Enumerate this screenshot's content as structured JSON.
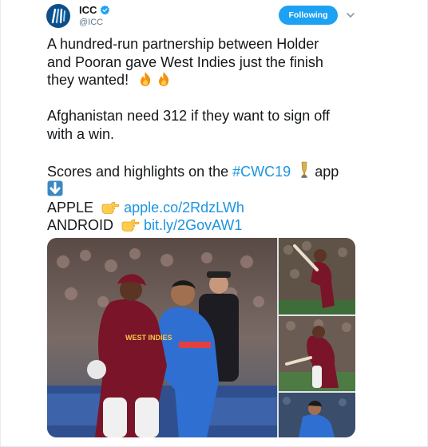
{
  "account": {
    "display_name": "ICC",
    "handle": "@ICC",
    "avatar_icon": "icc-logo-icon",
    "verified_icon": "verified-badge-icon",
    "verified_color": "#1da1f2"
  },
  "follow_button": {
    "label": "Following",
    "color": "#1da1f2"
  },
  "menu_icon": "chevron-down-icon",
  "tweet": {
    "p1": {
      "line1": "A hundred-run partnership between Holder",
      "line2": "and Pooran gave West Indies just the finish",
      "line3": "they wanted!"
    },
    "p2": {
      "line1": "Afghanistan need 312 if they want to sign off",
      "line2": "with a win."
    },
    "p3": {
      "line1_text": "Scores and highlights on the ",
      "hashtag": "#CWC19",
      "line1_suffix": " app",
      "apple_label": "APPLE",
      "apple_link": "apple.co/2RdzLWh",
      "android_label": "ANDROID",
      "android_link": "bit.ly/2GovAW1"
    },
    "emojis": [
      "fire-icon",
      "fire-icon",
      "trophy-icon",
      "down-arrow-icon",
      "pointing-hand-icon",
      "pointing-hand-icon"
    ],
    "link_color": "#1b95e0"
  },
  "media": {
    "photos": [
      "west-indies-afghanistan-collision-photo",
      "batsman-pull-shot-photo",
      "batsman-sweep-shot-photo",
      "afghanistan-batsman-photo"
    ],
    "jersey_text": "WEST INDIES"
  }
}
